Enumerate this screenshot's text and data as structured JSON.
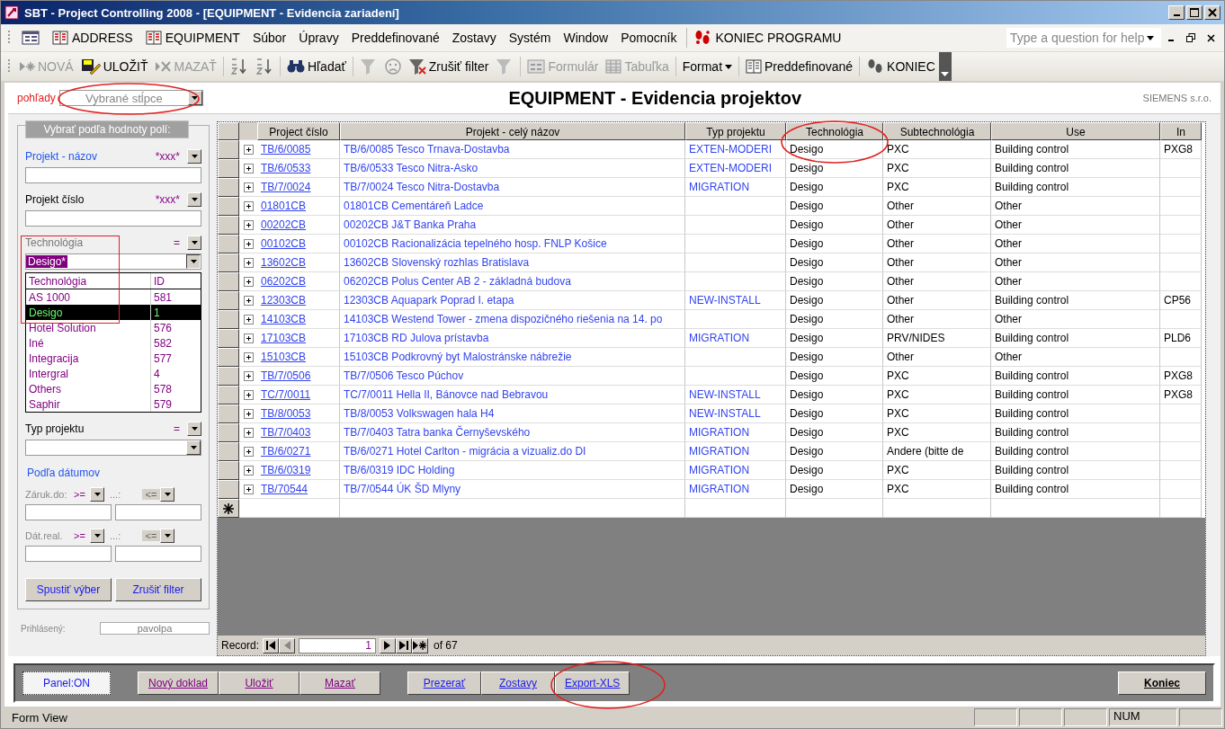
{
  "window": {
    "title": "SBT - Project Controlling 2008 - [EQUIPMENT - Evidencia zariadení]"
  },
  "menu_bar": {
    "items": [
      {
        "kind": "form"
      },
      {
        "kind": "table",
        "label": "ADDRESS"
      },
      {
        "kind": "table",
        "label": "EQUIPMENT"
      },
      {
        "kind": "menu",
        "label": "Súbor"
      },
      {
        "kind": "menu",
        "label": "Úpravy"
      },
      {
        "kind": "menu",
        "label": "Preddefinované"
      },
      {
        "kind": "menu",
        "label": "Zostavy"
      },
      {
        "kind": "menu",
        "label": "Systém"
      },
      {
        "kind": "menu",
        "label": "Window"
      },
      {
        "kind": "menu",
        "label": "Pomocník"
      },
      {
        "kind": "exit",
        "label": "KONIEC PROGRAMU"
      }
    ],
    "help_placeholder": "Type a question for help"
  },
  "toolbar": [
    [
      {
        "kind": "new",
        "label": "NOVÁ",
        "disabled": true
      },
      {
        "kind": "save",
        "label": "ULOŽIŤ",
        "disabled": false
      },
      {
        "kind": "delete",
        "label": "MAZAŤ",
        "disabled": true
      }
    ],
    [
      {
        "kind": "sort-asc",
        "disabled": false
      },
      {
        "kind": "sort-desc",
        "disabled": false
      }
    ],
    [
      {
        "kind": "find",
        "label": "Hľadať",
        "disabled": false
      }
    ],
    [
      {
        "kind": "filter-form",
        "disabled": true
      },
      {
        "kind": "smiley",
        "disabled": true
      },
      {
        "kind": "filter-remove",
        "label": "Zrušiť filter",
        "disabled": false
      },
      {
        "kind": "filter",
        "disabled": true
      }
    ],
    [
      {
        "kind": "form",
        "label": "Formulár",
        "disabled": true
      },
      {
        "kind": "grid",
        "label": "Tabuľka",
        "disabled": true
      }
    ],
    [
      {
        "kind": "menu",
        "label": "Format",
        "disabled": false
      }
    ],
    [
      {
        "kind": "book",
        "label": "Preddefinované",
        "disabled": false
      }
    ],
    [
      {
        "kind": "exit",
        "label": "KONIEC",
        "disabled": false
      }
    ]
  ],
  "header": {
    "views_label": "pohľady",
    "views_value": "Vybrané stĺpce",
    "title": "EQUIPMENT - Evidencia projektov",
    "company": "SIEMENS s.r.o."
  },
  "filter_panel": {
    "title": "Vybrať podľa hodnoty polí:",
    "fields": [
      {
        "label": "Projekt - názov",
        "active": true,
        "disabled": false,
        "operator": "*xxx*",
        "kind": "text"
      },
      {
        "label": "Projekt číslo",
        "active": false,
        "disabled": false,
        "operator": "*xxx*",
        "kind": "text"
      },
      {
        "label": "Technológia",
        "active": false,
        "disabled": true,
        "operator": "=",
        "kind": "combo",
        "value": "Desigo*",
        "expanded": true,
        "list_headers": [
          "Technológia",
          "ID"
        ],
        "options": [
          {
            "name": "AS 1000",
            "id": "581",
            "selected": false
          },
          {
            "name": "Desigo",
            "id": "1",
            "selected": true
          },
          {
            "name": "Hotel Solution",
            "id": "576",
            "selected": false
          },
          {
            "name": "Iné",
            "id": "582",
            "selected": false
          },
          {
            "name": "Integracija",
            "id": "577",
            "selected": false
          },
          {
            "name": "Intergral",
            "id": "4",
            "selected": false
          },
          {
            "name": "Others",
            "id": "578",
            "selected": false
          },
          {
            "name": "Saphir",
            "id": "579",
            "selected": false
          }
        ]
      },
      {
        "label": "Typ projektu",
        "active": false,
        "disabled": false,
        "operator": "=",
        "kind": "combo",
        "expanded": false
      }
    ],
    "dates_title": "Podľa dátumov",
    "date_filters": [
      {
        "label": "Záruk.do:",
        "from_op": ">=",
        "to_label": "...:",
        "to_op": "<=",
        "to_disabled": true
      },
      {
        "label": "Dát.real.",
        "from_op": ">=",
        "to_label": "...:",
        "to_op": "<=",
        "to_disabled": true
      }
    ],
    "buttons": [
      "Spustiť výber",
      "Zrušiť filter"
    ],
    "login_label": "Prihlásený:",
    "login_user": "pavolpa"
  },
  "table": {
    "columns": [
      {
        "label": "Project číslo",
        "kind": "hyperlink"
      },
      {
        "label": "Projekt - celý názov",
        "kind": "related"
      },
      {
        "label": "Typ projektu",
        "kind": "related"
      },
      {
        "label": "Technológia",
        "kind": "plain"
      },
      {
        "label": "Subtechnológia",
        "kind": "plain"
      },
      {
        "label": "Use",
        "kind": "plain"
      },
      {
        "label": "In",
        "kind": "plain"
      }
    ],
    "rows": [
      [
        "TB/6/0085",
        "TB/6/0085 Tesco Trnava-Dostavba",
        "EXTEN-MODERI",
        "Desigo",
        "PXC",
        "Building control",
        "PXG8"
      ],
      [
        "TB/6/0533",
        "TB/6/0533 Tesco Nitra-Asko",
        "EXTEN-MODERI",
        "Desigo",
        "PXC",
        "Building control",
        null
      ],
      [
        "TB/7/0024",
        "TB/7/0024 Tesco Nitra-Dostavba",
        "MIGRATION",
        "Desigo",
        "PXC",
        "Building control",
        null
      ],
      [
        "01801CB",
        "01801CB Cementáreň Ladce",
        null,
        "Desigo",
        "Other",
        "Other",
        null
      ],
      [
        "00202CB",
        "00202CB J&T Banka Praha",
        null,
        "Desigo",
        "Other",
        "Other",
        null
      ],
      [
        "00102CB",
        "00102CB Racionalizácia tepelného hosp. FNLP Košice",
        null,
        "Desigo",
        "Other",
        "Other",
        null
      ],
      [
        "13602CB",
        "13602CB Slovenský rozhlas Bratislava",
        null,
        "Desigo",
        "Other",
        "Other",
        null
      ],
      [
        "06202CB",
        "06202CB Polus Center AB 2 - základná budova",
        null,
        "Desigo",
        "Other",
        "Other",
        null
      ],
      [
        "12303CB",
        "12303CB Aquapark Poprad I. etapa",
        "NEW-INSTALL",
        "Desigo",
        "Other",
        "Building control",
        "CP56"
      ],
      [
        "14103CB",
        "14103CB Westend Tower - zmena dispozičného riešenia na 14. po",
        null,
        "Desigo",
        "Other",
        "Other",
        null
      ],
      [
        "17103CB",
        "17103CB RD Julova prístavba",
        "MIGRATION",
        "Desigo",
        "PRV/NIDES",
        "Building control",
        "PLD6"
      ],
      [
        "15103CB",
        "15103CB Podkrovný byt Malostránske nábrežie",
        null,
        "Desigo",
        "Other",
        "Other",
        null
      ],
      [
        "TB/7/0506",
        "TB/7/0506 Tesco Púchov",
        null,
        "Desigo",
        "PXC",
        "Building control",
        "PXG8"
      ],
      [
        "TC/7/0011",
        "TC/7/0011 Hella II, Bánovce nad Bebravou",
        "NEW-INSTALL",
        "Desigo",
        "PXC",
        "Building control",
        "PXG8"
      ],
      [
        "TB/8/0053",
        "TB/8/0053 Volkswagen hala H4",
        "NEW-INSTALL",
        "Desigo",
        "PXC",
        "Building control",
        null
      ],
      [
        "TB/7/0403",
        "TB/7/0403 Tatra banka Černyševského",
        "MIGRATION",
        "Desigo",
        "PXC",
        "Building control",
        null
      ],
      [
        "TB/6/0271",
        "TB/6/0271 Hotel Carlton - migrácia a vizualiz.do DI",
        "MIGRATION",
        "Desigo",
        "Andere (bitte de",
        "Building control",
        null
      ],
      [
        "TB/6/0319",
        "TB/6/0319 IDC Holding",
        "MIGRATION",
        "Desigo",
        "PXC",
        "Building control",
        null
      ],
      [
        "TB/70544",
        "TB/7/0544 ÚK ŠD Mlyny",
        "MIGRATION",
        "Desigo",
        "PXC",
        "Building control",
        null
      ]
    ]
  },
  "navigator": {
    "label": "Record:",
    "current": "1",
    "total": "of 67"
  },
  "bottom_buttons": [
    {
      "label": "Panel:ON",
      "kind": "toggle"
    },
    {
      "label": "Nový doklad",
      "kind": "record"
    },
    {
      "label": "Uložiť",
      "kind": "record"
    },
    {
      "label": "Mazať",
      "kind": "record"
    },
    {
      "label": "Prezerať",
      "kind": "view"
    },
    {
      "label": "Zostavy",
      "kind": "view"
    },
    {
      "label": "Export-XLS",
      "kind": "view"
    },
    {
      "label": "Koniec",
      "kind": "exit"
    }
  ],
  "status_bar": {
    "mode": "Form View",
    "num": "NUM"
  }
}
